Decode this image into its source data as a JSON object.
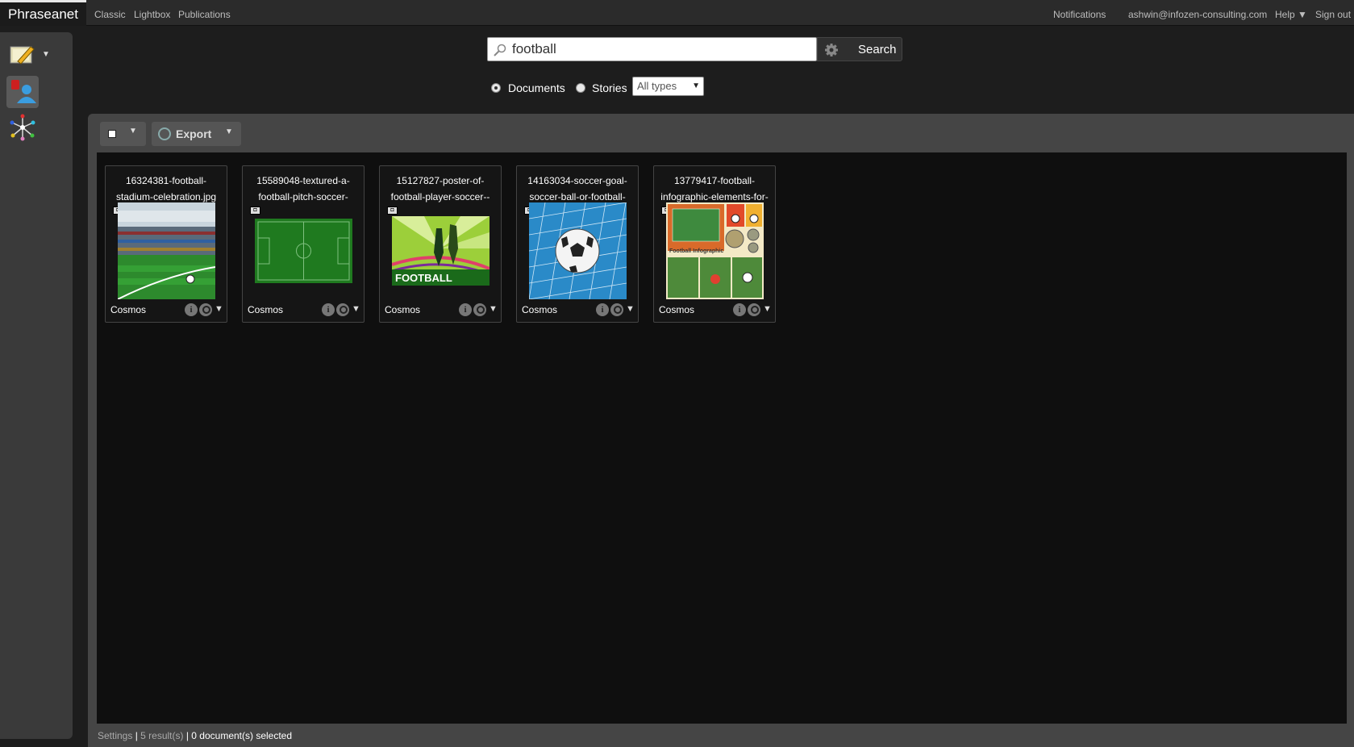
{
  "app": {
    "brand": "Phraseanet",
    "nav": [
      {
        "label": "Classic"
      },
      {
        "label": "Lightbox"
      },
      {
        "label": "Publications"
      }
    ],
    "right_nav": {
      "notifications": "Notifications",
      "user": "ashwin@infozen-consulting.com",
      "help": "Help ▼",
      "signout": "Sign out"
    }
  },
  "sidebar": {
    "items": [
      {
        "icon": "edit-icon",
        "label": ""
      },
      {
        "icon": "users-icon",
        "label": ""
      },
      {
        "icon": "thesaurus-icon",
        "label": ""
      }
    ]
  },
  "search": {
    "query": "football",
    "button_label": "Search",
    "settings_icon": "gear-icon",
    "search_icon": "search-icon",
    "scope_options": [
      {
        "label": "Documents",
        "checked": true
      },
      {
        "label": "Stories",
        "checked": false
      }
    ],
    "type_select": "All types"
  },
  "toolbar": {
    "export_label": "Export"
  },
  "results": [
    {
      "title": "16324381-football-stadium-celebration.jpg",
      "database": "Cosmos",
      "thumb": "stadium"
    },
    {
      "title": "15589048-textured-a-football-pitch-soccer-",
      "database": "Cosmos",
      "thumb": "pitch"
    },
    {
      "title": "15127827-poster-of-football-player-soccer--",
      "database": "Cosmos",
      "thumb": "poster",
      "thumb_text": "FOOTBALL"
    },
    {
      "title": "14163034-soccer-goal-soccer-ball-or-football-",
      "database": "Cosmos",
      "thumb": "ball"
    },
    {
      "title": "13779417-football-infographic-elements-for-",
      "database": "Cosmos",
      "thumb": "infographic",
      "thumb_text": "Football Infographic"
    }
  ],
  "statusbar": {
    "settings": "Settings",
    "results": "5 result(s)",
    "selected": "0 document(s) selected"
  },
  "colors": {
    "background": "#1d1d1d",
    "panel": "#454545",
    "results_bg": "#0f0f0f",
    "pitch_green": "#2d8a2d"
  }
}
